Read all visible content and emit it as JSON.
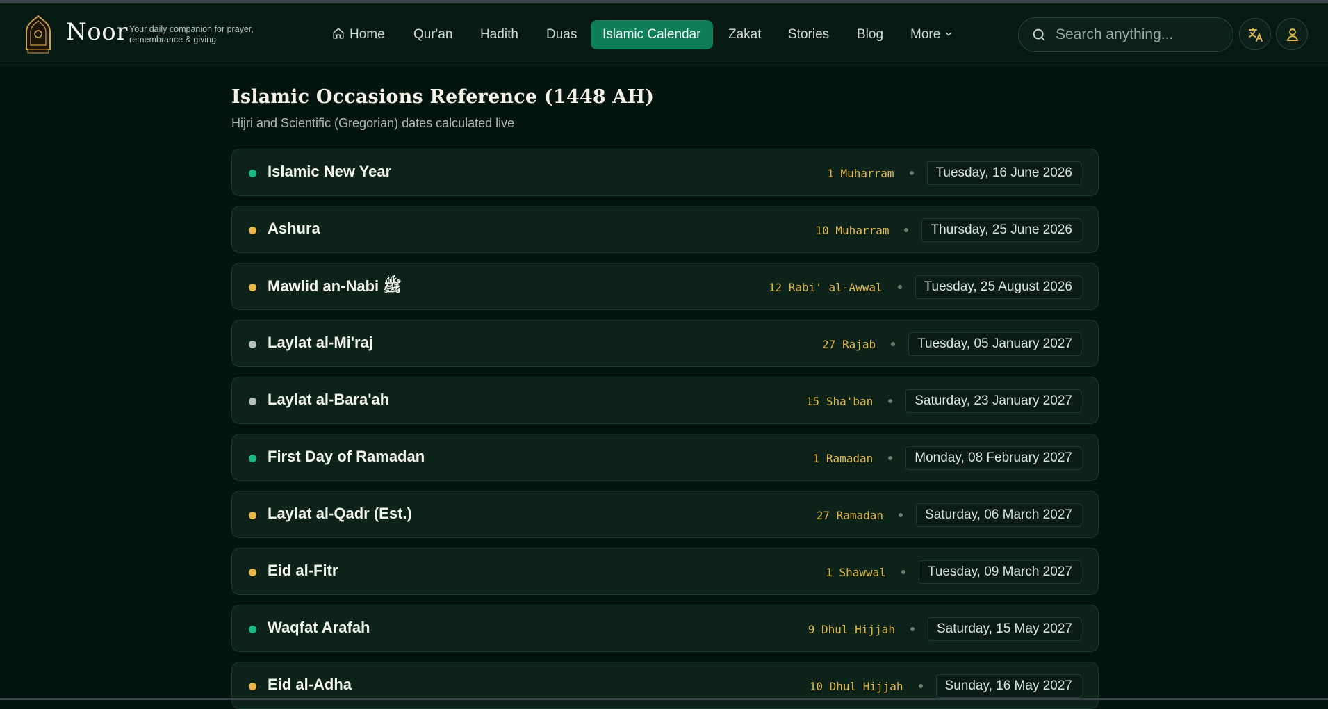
{
  "header": {
    "brand_name": "Noor",
    "tagline": "Your daily companion for prayer, remembrance & giving",
    "logo_text": "NOOR",
    "nav": [
      {
        "label": "Home",
        "icon": "home-icon"
      },
      {
        "label": "Qur'an"
      },
      {
        "label": "Hadith"
      },
      {
        "label": "Duas"
      },
      {
        "label": "Islamic Calendar",
        "active": true
      },
      {
        "label": "Zakat"
      },
      {
        "label": "Stories"
      },
      {
        "label": "Blog"
      },
      {
        "label": "More",
        "icon": "chevron-down-icon"
      }
    ],
    "search": {
      "placeholder": "Search anything..."
    },
    "icons": {
      "language": "translate-icon",
      "profile": "user-icon"
    }
  },
  "main": {
    "title": "Islamic Occasions Reference (1448 AH)",
    "subtitle": "Hijri and Scientific (Gregorian) dates calculated live",
    "occasions": [
      {
        "name": "Islamic New Year",
        "hijri": "1 Muharram",
        "gregorian": "Tuesday, 16 June 2026",
        "dot_color": "#1db983"
      },
      {
        "name": "Ashura",
        "hijri": "10 Muharram",
        "gregorian": "Thursday, 25 June 2026",
        "dot_color": "#e8b84a"
      },
      {
        "name": "Mawlid an-Nabi ﷺ",
        "hijri": "12 Rabi' al-Awwal",
        "gregorian": "Tuesday, 25 August 2026",
        "dot_color": "#e8b84a"
      },
      {
        "name": "Laylat al-Mi'raj",
        "hijri": "27 Rajab",
        "gregorian": "Tuesday, 05 January 2027",
        "dot_color": "#b8c3bd"
      },
      {
        "name": "Laylat al-Bara'ah",
        "hijri": "15 Sha'ban",
        "gregorian": "Saturday, 23 January 2027",
        "dot_color": "#b8c3bd"
      },
      {
        "name": "First Day of Ramadan",
        "hijri": "1 Ramadan",
        "gregorian": "Monday, 08 February 2027",
        "dot_color": "#1db983"
      },
      {
        "name": "Laylat al-Qadr (Est.)",
        "hijri": "27 Ramadan",
        "gregorian": "Saturday, 06 March 2027",
        "dot_color": "#e8b84a"
      },
      {
        "name": "Eid al-Fitr",
        "hijri": "1 Shawwal",
        "gregorian": "Tuesday, 09 March 2027",
        "dot_color": "#e8b84a"
      },
      {
        "name": "Waqfat Arafah",
        "hijri": "9 Dhul Hijjah",
        "gregorian": "Saturday, 15 May 2027",
        "dot_color": "#1db983"
      },
      {
        "name": "Eid al-Adha",
        "hijri": "10 Dhul Hijjah",
        "gregorian": "Sunday, 16 May 2027",
        "dot_color": "#e8b84a"
      }
    ]
  },
  "colors": {
    "background": "#04140f",
    "accent": "#0f7d58",
    "gold": "#e0b84a"
  }
}
